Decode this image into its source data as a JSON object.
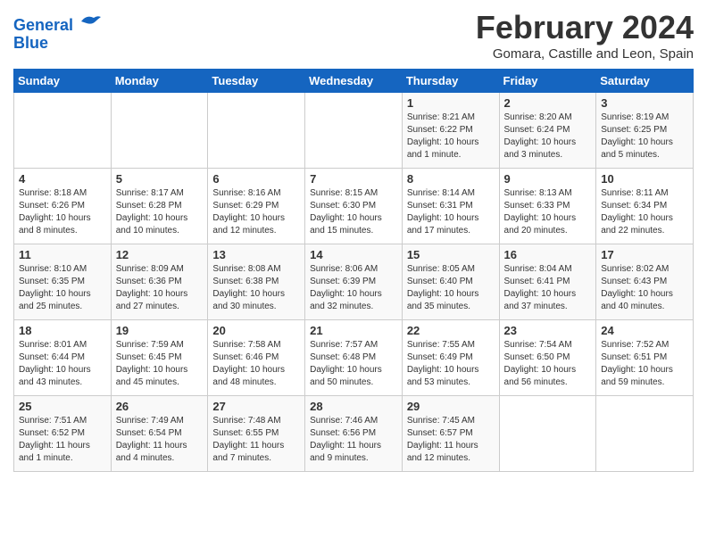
{
  "header": {
    "logo_line1": "General",
    "logo_line2": "Blue",
    "month": "February 2024",
    "location": "Gomara, Castille and Leon, Spain"
  },
  "days_of_week": [
    "Sunday",
    "Monday",
    "Tuesday",
    "Wednesday",
    "Thursday",
    "Friday",
    "Saturday"
  ],
  "weeks": [
    [
      {
        "day": "",
        "info": ""
      },
      {
        "day": "",
        "info": ""
      },
      {
        "day": "",
        "info": ""
      },
      {
        "day": "",
        "info": ""
      },
      {
        "day": "1",
        "info": "Sunrise: 8:21 AM\nSunset: 6:22 PM\nDaylight: 10 hours\nand 1 minute."
      },
      {
        "day": "2",
        "info": "Sunrise: 8:20 AM\nSunset: 6:24 PM\nDaylight: 10 hours\nand 3 minutes."
      },
      {
        "day": "3",
        "info": "Sunrise: 8:19 AM\nSunset: 6:25 PM\nDaylight: 10 hours\nand 5 minutes."
      }
    ],
    [
      {
        "day": "4",
        "info": "Sunrise: 8:18 AM\nSunset: 6:26 PM\nDaylight: 10 hours\nand 8 minutes."
      },
      {
        "day": "5",
        "info": "Sunrise: 8:17 AM\nSunset: 6:28 PM\nDaylight: 10 hours\nand 10 minutes."
      },
      {
        "day": "6",
        "info": "Sunrise: 8:16 AM\nSunset: 6:29 PM\nDaylight: 10 hours\nand 12 minutes."
      },
      {
        "day": "7",
        "info": "Sunrise: 8:15 AM\nSunset: 6:30 PM\nDaylight: 10 hours\nand 15 minutes."
      },
      {
        "day": "8",
        "info": "Sunrise: 8:14 AM\nSunset: 6:31 PM\nDaylight: 10 hours\nand 17 minutes."
      },
      {
        "day": "9",
        "info": "Sunrise: 8:13 AM\nSunset: 6:33 PM\nDaylight: 10 hours\nand 20 minutes."
      },
      {
        "day": "10",
        "info": "Sunrise: 8:11 AM\nSunset: 6:34 PM\nDaylight: 10 hours\nand 22 minutes."
      }
    ],
    [
      {
        "day": "11",
        "info": "Sunrise: 8:10 AM\nSunset: 6:35 PM\nDaylight: 10 hours\nand 25 minutes."
      },
      {
        "day": "12",
        "info": "Sunrise: 8:09 AM\nSunset: 6:36 PM\nDaylight: 10 hours\nand 27 minutes."
      },
      {
        "day": "13",
        "info": "Sunrise: 8:08 AM\nSunset: 6:38 PM\nDaylight: 10 hours\nand 30 minutes."
      },
      {
        "day": "14",
        "info": "Sunrise: 8:06 AM\nSunset: 6:39 PM\nDaylight: 10 hours\nand 32 minutes."
      },
      {
        "day": "15",
        "info": "Sunrise: 8:05 AM\nSunset: 6:40 PM\nDaylight: 10 hours\nand 35 minutes."
      },
      {
        "day": "16",
        "info": "Sunrise: 8:04 AM\nSunset: 6:41 PM\nDaylight: 10 hours\nand 37 minutes."
      },
      {
        "day": "17",
        "info": "Sunrise: 8:02 AM\nSunset: 6:43 PM\nDaylight: 10 hours\nand 40 minutes."
      }
    ],
    [
      {
        "day": "18",
        "info": "Sunrise: 8:01 AM\nSunset: 6:44 PM\nDaylight: 10 hours\nand 43 minutes."
      },
      {
        "day": "19",
        "info": "Sunrise: 7:59 AM\nSunset: 6:45 PM\nDaylight: 10 hours\nand 45 minutes."
      },
      {
        "day": "20",
        "info": "Sunrise: 7:58 AM\nSunset: 6:46 PM\nDaylight: 10 hours\nand 48 minutes."
      },
      {
        "day": "21",
        "info": "Sunrise: 7:57 AM\nSunset: 6:48 PM\nDaylight: 10 hours\nand 50 minutes."
      },
      {
        "day": "22",
        "info": "Sunrise: 7:55 AM\nSunset: 6:49 PM\nDaylight: 10 hours\nand 53 minutes."
      },
      {
        "day": "23",
        "info": "Sunrise: 7:54 AM\nSunset: 6:50 PM\nDaylight: 10 hours\nand 56 minutes."
      },
      {
        "day": "24",
        "info": "Sunrise: 7:52 AM\nSunset: 6:51 PM\nDaylight: 10 hours\nand 59 minutes."
      }
    ],
    [
      {
        "day": "25",
        "info": "Sunrise: 7:51 AM\nSunset: 6:52 PM\nDaylight: 11 hours\nand 1 minute."
      },
      {
        "day": "26",
        "info": "Sunrise: 7:49 AM\nSunset: 6:54 PM\nDaylight: 11 hours\nand 4 minutes."
      },
      {
        "day": "27",
        "info": "Sunrise: 7:48 AM\nSunset: 6:55 PM\nDaylight: 11 hours\nand 7 minutes."
      },
      {
        "day": "28",
        "info": "Sunrise: 7:46 AM\nSunset: 6:56 PM\nDaylight: 11 hours\nand 9 minutes."
      },
      {
        "day": "29",
        "info": "Sunrise: 7:45 AM\nSunset: 6:57 PM\nDaylight: 11 hours\nand 12 minutes."
      },
      {
        "day": "",
        "info": ""
      },
      {
        "day": "",
        "info": ""
      }
    ]
  ]
}
